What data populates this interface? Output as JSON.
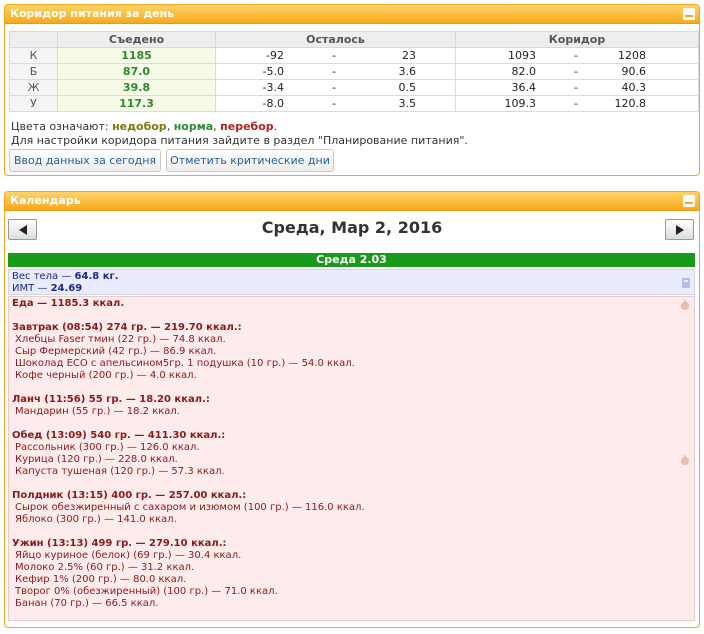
{
  "corridor_panel": {
    "title": "Коридор питания за день",
    "headers": {
      "eaten": "Съедено",
      "remaining": "Осталось",
      "corridor": "Коридор"
    },
    "rows": [
      {
        "label": "К",
        "eaten": "1185",
        "rem_from": "-92",
        "rem_sep": "-",
        "rem_to": "23",
        "cor_from": "1093",
        "cor_sep": "-",
        "cor_to": "1208"
      },
      {
        "label": "Б",
        "eaten": "87.0",
        "rem_from": "-5.0",
        "rem_sep": "-",
        "rem_to": "3.6",
        "cor_from": "82.0",
        "cor_sep": "-",
        "cor_to": "90.6"
      },
      {
        "label": "Ж",
        "eaten": "39.8",
        "rem_from": "-3.4",
        "rem_sep": "-",
        "rem_to": "0.5",
        "cor_from": "36.4",
        "cor_sep": "-",
        "cor_to": "40.3"
      },
      {
        "label": "У",
        "eaten": "117.3",
        "rem_from": "-8.0",
        "rem_sep": "-",
        "rem_to": "3.5",
        "cor_from": "109.3",
        "cor_sep": "-",
        "cor_to": "120.8"
      }
    ],
    "legend": {
      "prefix": "Цвета означают:",
      "under": "недобор",
      "sep1": ",",
      "norm": "норма",
      "sep2": ",",
      "over": "перебор",
      "end": "."
    },
    "hint": "Для настройки коридора питания зайдите в раздел \"Планирование питания\".",
    "buttons": {
      "enter_today": "Ввод данных за сегодня",
      "critical_days": "Отметить критические дни"
    },
    "colors": {
      "under": "#7a7a10",
      "norm": "#2d8a2d",
      "over": "#b22222"
    }
  },
  "calendar_panel": {
    "title": "Календарь",
    "date": "Среда, Мар 2, 2016",
    "day_label": "Среда 2.03",
    "weight_text": "Вес тела — ",
    "weight_value": "64.8 кг.",
    "bmi_text": "ИМТ — ",
    "bmi_value": "24.69",
    "food_total": "Еда — 1185.3 ккал.",
    "meals": [
      {
        "title": "Завтрак (08:54) 274 гр. — 219.70 ккал.:",
        "items": [
          "Хлебцы Faser тмин (22 гр.) — 74.8 ккал.",
          "Сыр Фермерский (42 гр.) — 86.9 ккал.",
          "Шоколад ECO с апельсином5гр. 1 подушка (10 гр.) — 54.0 ккал.",
          "Кофе черный (200 гр.) — 4.0 ккал."
        ]
      },
      {
        "title": "Ланч (11:56) 55 гр. — 18.20 ккал.:",
        "items": [
          "Мандарин (55 гр.) — 18.2 ккал."
        ]
      },
      {
        "title": "Обед (13:09) 540 гр. — 411.30 ккал.:",
        "items": [
          "Рассольник (300 гр.) — 126.0 ккал.",
          "Курица (120 гр.) — 228.0 ккал.",
          "Капуста тушеная (120 гр.) — 57.3 ккал."
        ]
      },
      {
        "title": "Полдник (13:15) 400 гр. — 257.00 ккал.:",
        "items": [
          "Сырок обезжиренный с сахаром и изюмом (100 гр.) — 116.0 ккал.",
          "Яблоко (300 гр.) — 141.0 ккал."
        ]
      },
      {
        "title": "Ужин (13:13) 499 гр. — 279.10 ккал.:",
        "items": [
          "Яйцо куриное (белок) (69 гр.) — 30.4 ккал.",
          "Молоко 2.5% (60 гр.) — 31.2 ккал.",
          "Кефир 1% (200 гр.) — 80.0 ккал.",
          "Творог 0% (обезжиренный) (100 гр.) — 71.0 ккал.",
          "Банан (70 гр.) — 66.5 ккал."
        ]
      }
    ],
    "colors": {
      "day_bar": "#1a9a1a",
      "weight_bg": "#e9ecfc",
      "food_bg": "#fdeceb"
    }
  }
}
